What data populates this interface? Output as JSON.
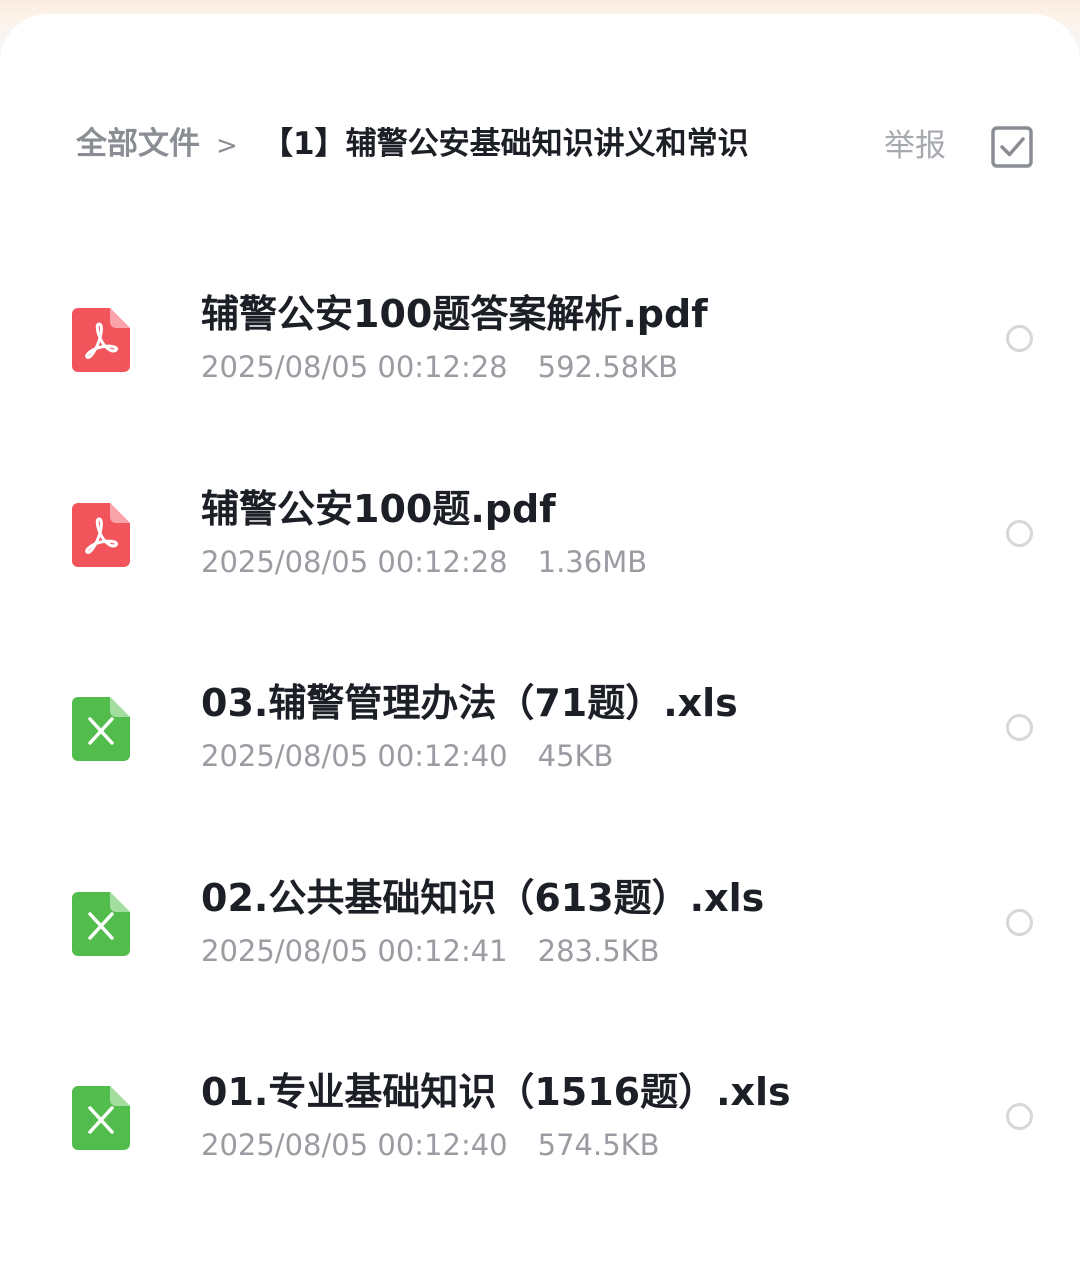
{
  "breadcrumb": {
    "root": "全部文件",
    "separator": ">",
    "current": "【1】辅警公安基础知识讲义和常识"
  },
  "actions": {
    "report_label": "举报",
    "select_icon": "checkbox-icon"
  },
  "colors": {
    "pdf": "#f2545b",
    "xls": "#52bd4d",
    "text_primary": "#1c1f26",
    "text_secondary": "#9a9ca2"
  },
  "files": [
    {
      "name": "辅警公安100题答案解析.pdf",
      "date": "2025/08/05 00:12:28",
      "size": "592.58KB",
      "type": "pdf",
      "icon": "pdf-file-icon"
    },
    {
      "name": "辅警公安100题.pdf",
      "date": "2025/08/05 00:12:28",
      "size": "1.36MB",
      "type": "pdf",
      "icon": "pdf-file-icon"
    },
    {
      "name": "03.辅警管理办法（71题）.xls",
      "date": "2025/08/05 00:12:40",
      "size": "45KB",
      "type": "xls",
      "icon": "excel-file-icon"
    },
    {
      "name": "02.公共基础知识（613题）.xls",
      "date": "2025/08/05 00:12:41",
      "size": "283.5KB",
      "type": "xls",
      "icon": "excel-file-icon"
    },
    {
      "name": "01.专业基础知识（1516题）.xls",
      "date": "2025/08/05 00:12:40",
      "size": "574.5KB",
      "type": "xls",
      "icon": "excel-file-icon"
    }
  ]
}
